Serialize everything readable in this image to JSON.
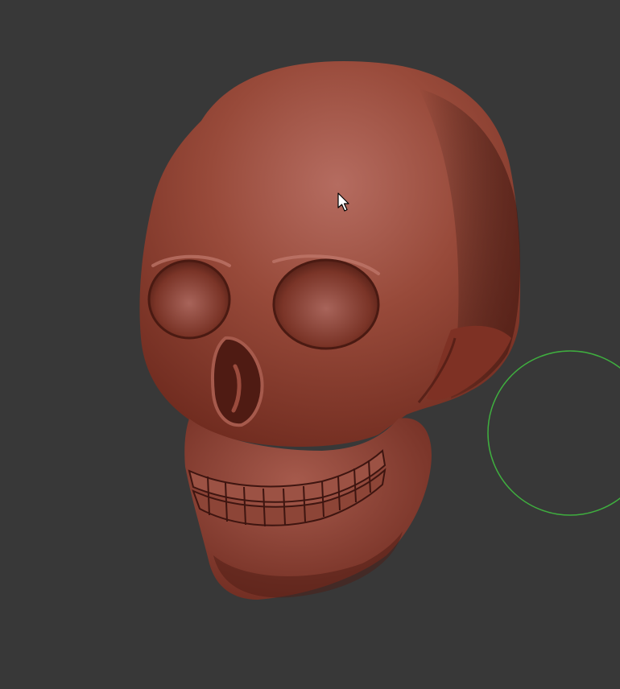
{
  "viewport": {
    "background": "#383838",
    "model": {
      "name": "skull-sculpt",
      "material_color": "#8a3b2c",
      "highlight_color": "#b8675a",
      "shadow_color": "#3e1510"
    },
    "brush_cursor": {
      "color": "#3fae3f"
    },
    "pointer": {
      "icon": "arrow-cursor-icon"
    }
  }
}
